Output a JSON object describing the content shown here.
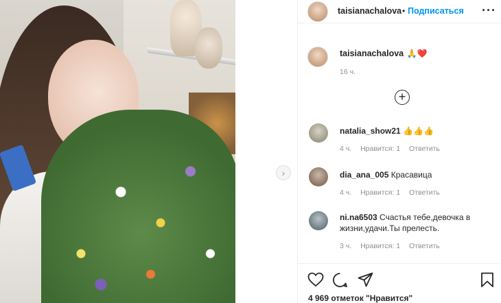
{
  "post": {
    "author": "taisianachalova",
    "follow_label": "Подписаться",
    "separator": "•",
    "more_label": "···"
  },
  "caption": {
    "username": "taisianachalova",
    "emoji": "🙏❤️",
    "time": "16 ч."
  },
  "load_more_label": "+",
  "comments": [
    {
      "username": "natalia_show21",
      "text": "👍👍👍",
      "time": "4 ч.",
      "likes": "Нравится: 1",
      "reply": "Ответить"
    },
    {
      "username": "dia_ana_005",
      "text": "Красавица",
      "time": "4 ч.",
      "likes": "Нравится: 1",
      "reply": "Ответить"
    },
    {
      "username": "ni.na6503",
      "text": "Счастья тебе,девочка в жизни,удачи.Ты прелесть.",
      "time": "3 ч.",
      "likes": "Нравится: 1",
      "reply": "Ответить"
    }
  ],
  "likes_line": "4 969 отметок \"Нравится\"",
  "carousel_next": "›",
  "icons": [
    "heart-icon",
    "comment-icon",
    "share-icon",
    "bookmark-icon",
    "plus-circle-icon",
    "chevron-right-icon"
  ]
}
